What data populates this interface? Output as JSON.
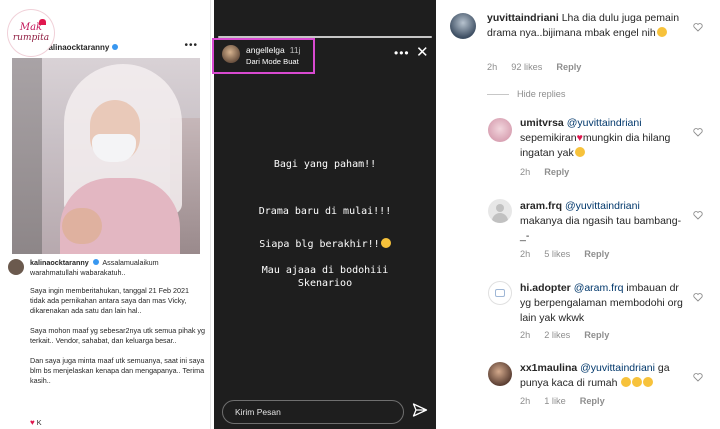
{
  "post": {
    "logo_line1": "Mak",
    "logo_line2": "rumpita",
    "username": "kalinaocktaranny",
    "more_icon": "more-horizontal-icon",
    "caption_username": "kalinaocktaranny",
    "caption_greeting": "Assalamualaikum warahmatullahi wabarakatuh..",
    "caption_paragraphs": [
      "Saya ingin memberitahukan, tanggal 21 Feb 2021 tidak ada pernikahan antara saya dan mas Vicky, dikarenakan ada satu dan lain hal..",
      "Saya mohon maaf yg sebesar2nya utk semua pihak yg terkait.. Vendor, sahabat, dan keluarga besar..",
      "Dan saya juga minta maaf utk semuanya, saat ini saya blm bs menjelaskan kenapa dan mengapanya.. Terima kasih.."
    ],
    "caption_sign": "K"
  },
  "story": {
    "username": "angellelga",
    "time": "11j",
    "subtitle": "Dari Mode Buat",
    "more_icon": "more-horizontal-icon",
    "close_icon": "close-icon",
    "lines": [
      "Bagi yang paham!!",
      "Drama baru di mulai!!!",
      "Siapa blg berakhir!!",
      "Mau ajaaa di bodohiii",
      "Skenarioo"
    ],
    "input_placeholder": "Kirim Pesan",
    "send_icon": "send-icon",
    "highlight_color": "#d84ad1"
  },
  "comments": {
    "hide_replies": "Hide replies",
    "items": [
      {
        "username": "yuvittaindriani",
        "mention": "",
        "text": "Lha dia dulu juga pemain drama nya..bijimana mbak engel nih",
        "time": "2h",
        "likes": "92 likes",
        "reply": "Reply"
      },
      {
        "username": "umitvrsa",
        "mention": "@yuvittaindriani",
        "text_before": "sepemikiran",
        "text_after": "mungkin dia hilang ingatan yak",
        "time": "2h",
        "likes": "",
        "reply": "Reply"
      },
      {
        "username": "aram.frq",
        "mention": "@yuvittaindriani",
        "text": "makanya dia ngasih tau bambang-_-",
        "time": "2h",
        "likes": "5 likes",
        "reply": "Reply"
      },
      {
        "username": "hi.adopter",
        "mention": "@aram.frq",
        "text": "imbauan dr yg berpengalaman membodohi org lain yak wkwk",
        "time": "2h",
        "likes": "2 likes",
        "reply": "Reply"
      },
      {
        "username": "xx1maulina",
        "mention": "@yuvittaindriani",
        "text": "ga punya kaca di rumah",
        "time": "2h",
        "likes": "1 like",
        "reply": "Reply"
      }
    ]
  }
}
